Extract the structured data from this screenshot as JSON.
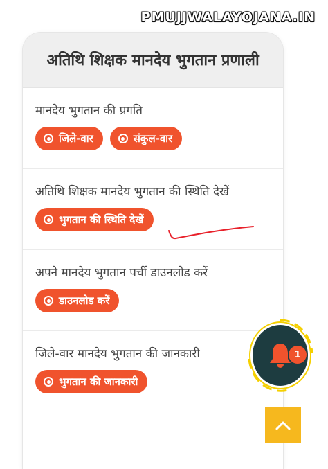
{
  "watermark": "PMUJJWALAYOJANA.IN",
  "card": {
    "title": "अतिथि शिक्षक मानदेय भुगतान प्रणाली"
  },
  "sections": [
    {
      "label": "मानदेय भुगतान की प्रगति",
      "buttons": [
        "जिले-वार",
        "संकुल-वार"
      ]
    },
    {
      "label": "अतिथि शिक्षक मानदेय भुगतान की स्थिति देखें",
      "buttons": [
        "भुगतान की स्थिति देखें"
      ]
    },
    {
      "label": "अपने मानदेय भुगतान पर्ची डाउनलोड करें",
      "buttons": [
        "डाउनलोड करें"
      ]
    },
    {
      "label": "जिले-वार मानदेय भुगतान की जानकारी",
      "buttons": [
        "भुगतान की जानकारी"
      ]
    }
  ],
  "notification": {
    "count": "1"
  },
  "colors": {
    "accent": "#f0532d",
    "bell_bg": "#1d3c40",
    "ring": "#f5d000",
    "scroll_top": "#f6b81e",
    "scribble": "#e8202a"
  },
  "icons": {
    "button_icon": "radio-dot-icon",
    "notification_icon": "bell-icon",
    "scroll_icon": "chevron-up-icon"
  }
}
